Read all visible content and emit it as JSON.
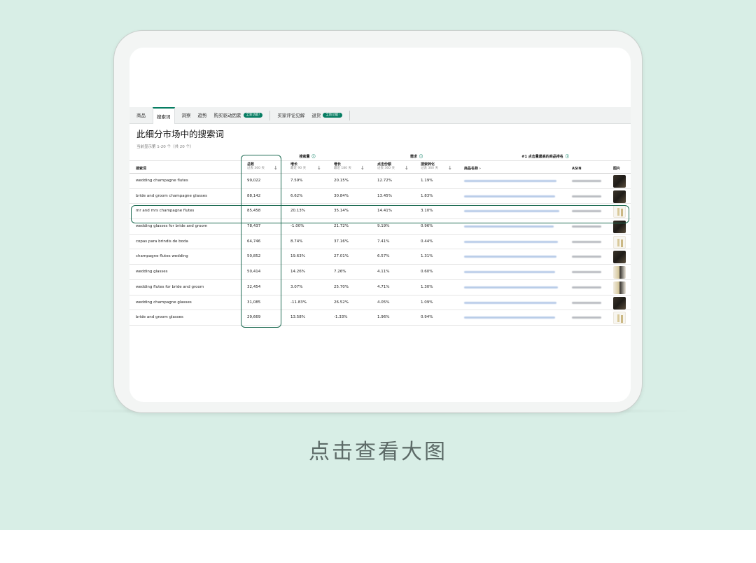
{
  "caption": "点击查看大图",
  "tabs": [
    {
      "label": "商品",
      "active": false
    },
    {
      "label": "搜索词",
      "active": true
    },
    {
      "label": "洞察",
      "active": false
    },
    {
      "label": "趋势",
      "active": false
    },
    {
      "label": "购买驱动因素",
      "active": false,
      "badge": "全新功能!"
    },
    {
      "label": "买家评论见解",
      "active": false
    },
    {
      "label": "退货",
      "active": false,
      "badge": "全新功能!"
    }
  ],
  "title": "此细分市场中的搜索词",
  "subtitle": "当前显示第 1-20 个（共 20 个）",
  "groups": {
    "search_volume": "搜索量",
    "demand": "需求",
    "top_product": "#1 点击量最高的商品排名",
    "help_icon": "ⓘ"
  },
  "headers": {
    "keyword": "搜索词",
    "total": "总数",
    "total_sub": "过去 360 天",
    "growth90": "增长",
    "growth90_sub": "最近 90 天",
    "growth180": "增长",
    "growth180_sub": "最近 180 天",
    "click_share": "点击份额",
    "click_share_sub": "过去 360 天",
    "conversion": "搜索转化",
    "conversion_sub": "过去 360 天",
    "product_name": "商品名称 ›",
    "asin": "ASIN",
    "image": "图片",
    "sort_arrow": "↓"
  },
  "rows": [
    {
      "keyword": "wedding champagne flutes",
      "total": "99,022",
      "g90": "7.59%",
      "g180": "20.15%",
      "click": "12.72%",
      "conv": "1.19%",
      "thumb": "dark"
    },
    {
      "keyword": "bride and groom champagne glasses",
      "total": "88,142",
      "g90": "6.62%",
      "g180": "30.84%",
      "click": "13.45%",
      "conv": "1.83%",
      "thumb": "dark"
    },
    {
      "keyword": "mr and mrs champagne flutes",
      "total": "85,458",
      "g90": "20.13%",
      "g180": "35.14%",
      "click": "14.41%",
      "conv": "3.10%",
      "thumb": "light"
    },
    {
      "keyword": "wedding glasses for bride and groom",
      "total": "78,437",
      "g90": "-1.00%",
      "g180": "21.72%",
      "click": "9.19%",
      "conv": "0.96%",
      "thumb": "dark"
    },
    {
      "keyword": "copas para brindis de boda",
      "total": "64,746",
      "g90": "8.74%",
      "g180": "37.16%",
      "click": "7.41%",
      "conv": "0.44%",
      "thumb": "light"
    },
    {
      "keyword": "champagne flutes wedding",
      "total": "50,852",
      "g90": "19.63%",
      "g180": "27.01%",
      "click": "6.57%",
      "conv": "1.31%",
      "thumb": "dark"
    },
    {
      "keyword": "wedding glasses",
      "total": "50,414",
      "g90": "14.26%",
      "g180": "7.26%",
      "click": "4.11%",
      "conv": "0.60%",
      "thumb": "mixed"
    },
    {
      "keyword": "wedding flutes for bride and groom",
      "total": "32,454",
      "g90": "3.07%",
      "g180": "25.70%",
      "click": "4.71%",
      "conv": "1.30%",
      "thumb": "mixed"
    },
    {
      "keyword": "wedding champagne glasses",
      "total": "31,085",
      "g90": "-11.83%",
      "g180": "26.52%",
      "click": "4.05%",
      "conv": "1.09%",
      "thumb": "dark"
    },
    {
      "keyword": "bride and groom glasses",
      "total": "29,669",
      "g90": "13.58%",
      "g180": "-1.33%",
      "click": "1.96%",
      "conv": "0.94%",
      "thumb": "light"
    }
  ],
  "colors": {
    "accent": "#067d62",
    "highlight_frame": "#1d6b52",
    "background": "#d8eee6"
  }
}
